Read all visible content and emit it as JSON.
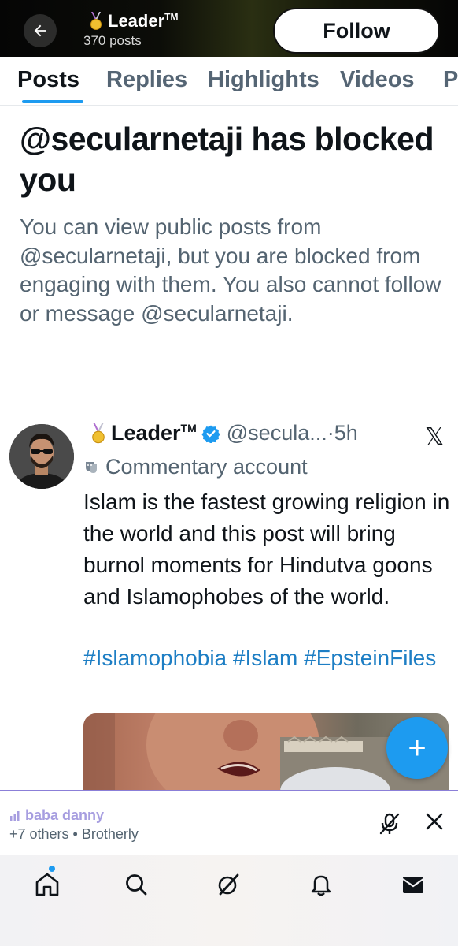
{
  "header": {
    "name": "Leader",
    "tm": "TM",
    "posts_count": "370 posts",
    "follow_label": "Follow"
  },
  "tabs": [
    {
      "label": "Posts",
      "active": true
    },
    {
      "label": "Replies",
      "active": false
    },
    {
      "label": "Highlights",
      "active": false
    },
    {
      "label": "Videos",
      "active": false
    },
    {
      "label": "P",
      "active": false
    }
  ],
  "blocked": {
    "title": "@secularnetaji has blocked you",
    "description": "You can view public posts from @secularnetaji, but you are blocked from engaging with them. You also cannot follow or message @secularnetaji."
  },
  "post": {
    "author_name": "Leader",
    "author_tm": "TM",
    "handle_time": "@secula...·5h",
    "badge_label": "Commentary account",
    "text": "Islam is the fastest growing religion in the world and this post will bring burnol moments for Hindutva goons and Islamophobes of the world.",
    "hashtags": "#Islamophobia #Islam #EpsteinFiles",
    "x_logo": "𝕏"
  },
  "fab": {
    "label": "+"
  },
  "space": {
    "title": "baba danny",
    "subtitle": "+7 others • Brotherly"
  },
  "nav": [
    "home-icon",
    "search-icon",
    "grok-icon",
    "notifications-icon",
    "messages-icon"
  ],
  "colors": {
    "accent": "#1d9bf0",
    "secondary_text": "#546471",
    "space_accent": "#a79ee0",
    "hashtag": "#1d7ec4"
  }
}
